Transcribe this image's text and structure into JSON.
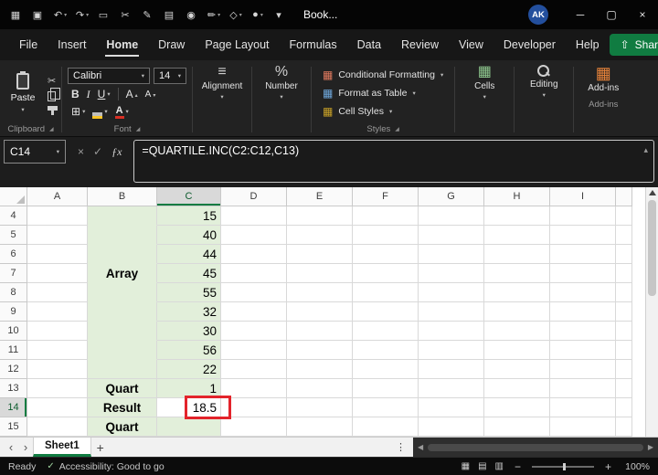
{
  "titlebar": {
    "title": "Book...",
    "avatar": "AK",
    "icons": [
      {
        "name": "app-icon",
        "glyph": "▦"
      },
      {
        "name": "save-icon",
        "glyph": "▣"
      },
      {
        "name": "undo-icon",
        "glyph": "↶",
        "caret": "▾"
      },
      {
        "name": "redo-icon",
        "glyph": "↷",
        "caret": "▾"
      },
      {
        "name": "copy-icon",
        "glyph": "▭"
      },
      {
        "name": "cut-icon",
        "glyph": "✂"
      },
      {
        "name": "format-painter-icon",
        "glyph": "✎"
      },
      {
        "name": "print-icon",
        "glyph": "▤"
      },
      {
        "name": "camera-icon",
        "glyph": "◉"
      },
      {
        "name": "draw-icon",
        "glyph": "✏",
        "caret": "▾"
      },
      {
        "name": "shapes-icon",
        "glyph": "◇",
        "caret": "▾"
      },
      {
        "name": "record-macro-icon",
        "glyph": "●",
        "caret": "▾"
      },
      {
        "name": "more-commands-icon",
        "glyph": "▾"
      }
    ],
    "window": {
      "minimize": "─",
      "maximize": "▢",
      "close": "×"
    }
  },
  "menubar": {
    "items": [
      {
        "name": "tab-file",
        "label": "File"
      },
      {
        "name": "tab-insert",
        "label": "Insert"
      },
      {
        "name": "tab-home",
        "label": "Home",
        "cls": "active"
      },
      {
        "name": "tab-draw",
        "label": "Draw"
      },
      {
        "name": "tab-page-layout",
        "label": "Page Layout"
      },
      {
        "name": "tab-formulas",
        "label": "Formulas"
      },
      {
        "name": "tab-data",
        "label": "Data"
      },
      {
        "name": "tab-review",
        "label": "Review"
      },
      {
        "name": "tab-view",
        "label": "View"
      },
      {
        "name": "tab-developer",
        "label": "Developer"
      },
      {
        "name": "tab-help",
        "label": "Help"
      }
    ],
    "share_label": "Share",
    "share_icon": "⇧",
    "share_caret": "▾"
  },
  "ribbon": {
    "paste_label": "Paste",
    "font_name": "Calibri",
    "font_size": "14",
    "alignment_label": "Alignment",
    "number_label": "Number",
    "cells_label": "Cells",
    "editing_label": "Editing",
    "addins_label": "Add-ins",
    "groups": {
      "clipboard": "Clipboard",
      "font": "Font",
      "styles": "Styles",
      "addins": "Add-ins"
    },
    "styles_buttons": [
      {
        "name": "conditional-formatting-button",
        "icon": "▦",
        "label": "Conditional Formatting",
        "caret": "▾"
      },
      {
        "name": "format-as-table-button",
        "icon": "▦",
        "label": "Format as Table",
        "caret": "▾"
      },
      {
        "name": "cell-styles-button",
        "icon": "▦",
        "label": "Cell Styles",
        "caret": "▾"
      }
    ],
    "glyphs": {
      "caret": "▾",
      "dialog": "◢",
      "cut": "✂",
      "bold": "B",
      "italic": "I",
      "underline": "U",
      "grow": "A",
      "shrink": "A",
      "up": "▴",
      "down": "▾",
      "borders": "⊞",
      "font_color": "A",
      "alignment": "≡",
      "number": "%",
      "cells": "▦",
      "addins": "▦"
    }
  },
  "formula_bar": {
    "name_box": "C14",
    "name_caret": "▾",
    "cancel": "×",
    "enter": "✓",
    "fx": "ƒx",
    "formula": "=QUARTILE.INC(C2:C12,C13)",
    "collapse": "▴"
  },
  "grid": {
    "selected_cell": "C14",
    "column_headers": [
      "A",
      "B",
      "C",
      "D",
      "E",
      "F",
      "G",
      "H",
      "I",
      ""
    ],
    "selected_column_index": 2,
    "rows": [
      {
        "num": "4",
        "cells": [
          {},
          {
            "cls": "green nb"
          },
          {
            "t": "15",
            "cls": "green num"
          }
        ]
      },
      {
        "num": "5",
        "cells": [
          {},
          {
            "cls": "green nb"
          },
          {
            "t": "40",
            "cls": "green num"
          }
        ]
      },
      {
        "num": "6",
        "cells": [
          {},
          {
            "cls": "green nb"
          },
          {
            "t": "44",
            "cls": "green num"
          }
        ]
      },
      {
        "num": "7",
        "cells": [
          {},
          {
            "t": "Array",
            "cls": "green nb lbl"
          },
          {
            "t": "45",
            "cls": "green num"
          }
        ]
      },
      {
        "num": "8",
        "cells": [
          {},
          {
            "cls": "green nb"
          },
          {
            "t": "55",
            "cls": "green num"
          }
        ]
      },
      {
        "num": "9",
        "cells": [
          {},
          {
            "cls": "green nb"
          },
          {
            "t": "32",
            "cls": "green num"
          }
        ]
      },
      {
        "num": "10",
        "cells": [
          {},
          {
            "cls": "green nb"
          },
          {
            "t": "30",
            "cls": "green num"
          }
        ]
      },
      {
        "num": "11",
        "cells": [
          {},
          {
            "cls": "green nb"
          },
          {
            "t": "56",
            "cls": "green num"
          }
        ]
      },
      {
        "num": "12",
        "cells": [
          {},
          {
            "cls": "green"
          },
          {
            "t": "22",
            "cls": "green num"
          }
        ]
      },
      {
        "num": "13",
        "cells": [
          {},
          {
            "t": "Quart",
            "cls": "green lbl"
          },
          {
            "t": "1",
            "cls": "green num"
          }
        ]
      },
      {
        "num": "14",
        "sel": true,
        "cells": [
          {},
          {
            "t": "Result",
            "cls": "green lbl"
          },
          {
            "t": "18.5",
            "cls": "num selcell redbox"
          }
        ]
      },
      {
        "num": "15",
        "cells": [
          {},
          {
            "t": "Quart",
            "cls": "green lbl"
          },
          {
            "cls": "green"
          }
        ]
      }
    ]
  },
  "sheet_bar": {
    "nav_left": "‹",
    "nav_right": "›",
    "tab": "Sheet1",
    "add": "+",
    "more": "⋮",
    "scroll_left": "◀",
    "scroll_right": "▶"
  },
  "status_bar": {
    "ready": "Ready",
    "accessibility_icon": "✓",
    "accessibility": "Accessibility: Good to go",
    "view_icons": [
      {
        "name": "normal-view-icon",
        "glyph": "▦"
      },
      {
        "name": "page-layout-view-icon",
        "glyph": "▤"
      },
      {
        "name": "page-break-preview-icon",
        "glyph": "▥"
      }
    ],
    "zoom_out": "−",
    "zoom_in": "+",
    "zoom": "100%"
  },
  "colors": {
    "accent_green": "#107C41",
    "cell_fill_green": "#E2EFDA",
    "highlight_red": "#E3242B"
  }
}
